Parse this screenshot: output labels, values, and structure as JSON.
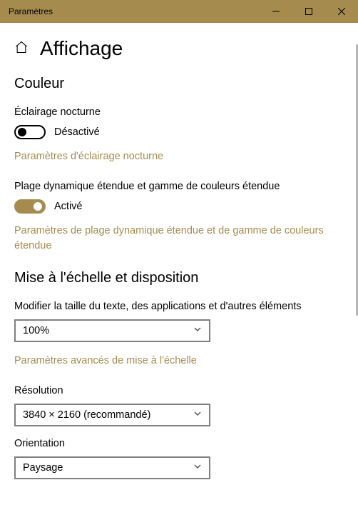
{
  "titlebar": {
    "title": "Paramètres"
  },
  "page": {
    "title": "Affichage"
  },
  "sections": {
    "color": {
      "title": "Couleur",
      "nightLight": {
        "label": "Éclairage nocturne",
        "state": "Désactivé",
        "link": "Paramètres d'éclairage nocturne"
      },
      "hdr": {
        "label": "Plage dynamique étendue et gamme de couleurs étendue",
        "state": "Activé",
        "link": "Paramètres de plage dynamique étendue et de gamme de couleurs étendue"
      }
    },
    "scale": {
      "title": "Mise à l'échelle et disposition",
      "textSize": {
        "label": "Modifier la taille du texte, des applications et d'autres éléments",
        "value": "100%",
        "link": "Paramètres avancés de mise à l'échelle"
      },
      "resolution": {
        "label": "Résolution",
        "value": "3840 × 2160 (recommandé)"
      },
      "orientation": {
        "label": "Orientation",
        "value": "Paysage"
      }
    }
  }
}
